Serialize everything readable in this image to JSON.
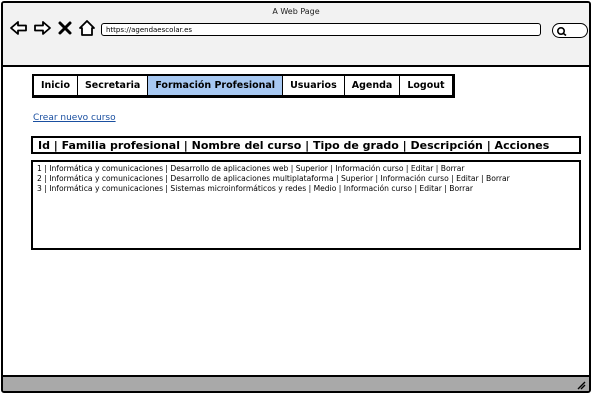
{
  "window": {
    "title": "A Web Page"
  },
  "browser": {
    "url": "https://agendaescolar.es"
  },
  "tabs": [
    {
      "label": "Inicio",
      "active": false
    },
    {
      "label": "Secretaria",
      "active": false
    },
    {
      "label": "Formación Profesional",
      "active": true
    },
    {
      "label": "Usuarios",
      "active": false
    },
    {
      "label": "Agenda",
      "active": false
    },
    {
      "label": "Logout",
      "active": false
    }
  ],
  "create_link": "Crear nuevo curso",
  "table": {
    "header": "Id | Familia profesional | Nombre del curso | Tipo de grado | Descripción | Acciones",
    "rows": [
      "1 | Informática y comunicaciones | Desarrollo de aplicaciones web | Superior | Información curso | Editar | Borrar",
      "2 | Informática y comunicaciones | Desarrollo de aplicaciones multiplataforma | Superior | Información curso | Editar | Borrar",
      "3 | Informática y comunicaciones | Sistemas microinformáticos y redes | Medio | Información curso | Editar | Borrar"
    ]
  },
  "colors": {
    "active_tab": "#a7c8f2",
    "link": "#1a4fa0",
    "statusbar": "#a9a9a9"
  }
}
